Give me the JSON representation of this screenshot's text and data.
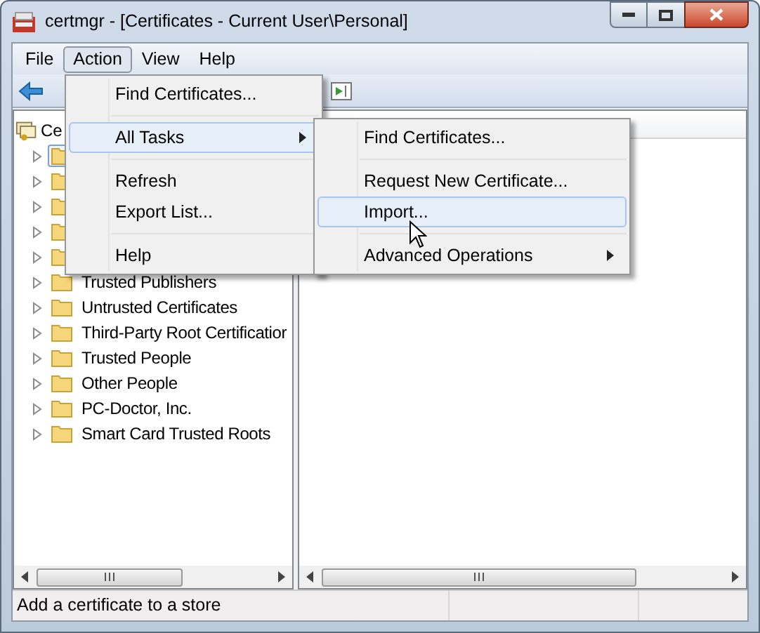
{
  "window": {
    "title": "certmgr - [Certificates - Current User\\Personal]"
  },
  "menu_bar": [
    {
      "label": "File",
      "selected": false
    },
    {
      "label": "Action",
      "selected": true
    },
    {
      "label": "View",
      "selected": false
    },
    {
      "label": "Help",
      "selected": false
    }
  ],
  "action_menu": [
    {
      "kind": "item",
      "label": "Find Certificates...",
      "selected": false
    },
    {
      "kind": "separator"
    },
    {
      "kind": "submenu",
      "label": "All Tasks",
      "selected": true
    },
    {
      "kind": "separator"
    },
    {
      "kind": "item",
      "label": "Refresh",
      "selected": false
    },
    {
      "kind": "item",
      "label": "Export List...",
      "selected": false
    },
    {
      "kind": "separator"
    },
    {
      "kind": "item",
      "label": "Help",
      "selected": false
    }
  ],
  "all_tasks_menu": [
    {
      "kind": "item",
      "label": "Find Certificates...",
      "selected": false
    },
    {
      "kind": "separator"
    },
    {
      "kind": "item",
      "label": "Request New Certificate...",
      "selected": false
    },
    {
      "kind": "item",
      "label": "Import...",
      "selected": true
    },
    {
      "kind": "separator"
    },
    {
      "kind": "submenu",
      "label": "Advanced Operations",
      "selected": false
    }
  ],
  "tree": {
    "label": "Ce",
    "children": [
      {
        "selected": true
      },
      {
        "selected": false
      },
      {
        "selected": false
      },
      {
        "selected": false
      },
      {
        "selected": false
      },
      {
        "label": "Trusted Publishers",
        "selected": false
      },
      {
        "label": "Untrusted Certificates",
        "selected": false
      },
      {
        "label": "Third-Party Root Certificatior",
        "selected": false
      },
      {
        "label": "Trusted People",
        "selected": false
      },
      {
        "label": "Other People",
        "selected": false
      },
      {
        "label": "PC-Doctor, Inc.",
        "selected": false
      },
      {
        "label": "Smart Card Trusted Roots",
        "selected": false
      }
    ]
  },
  "status_bar": {
    "text": "Add a certificate to a store"
  }
}
